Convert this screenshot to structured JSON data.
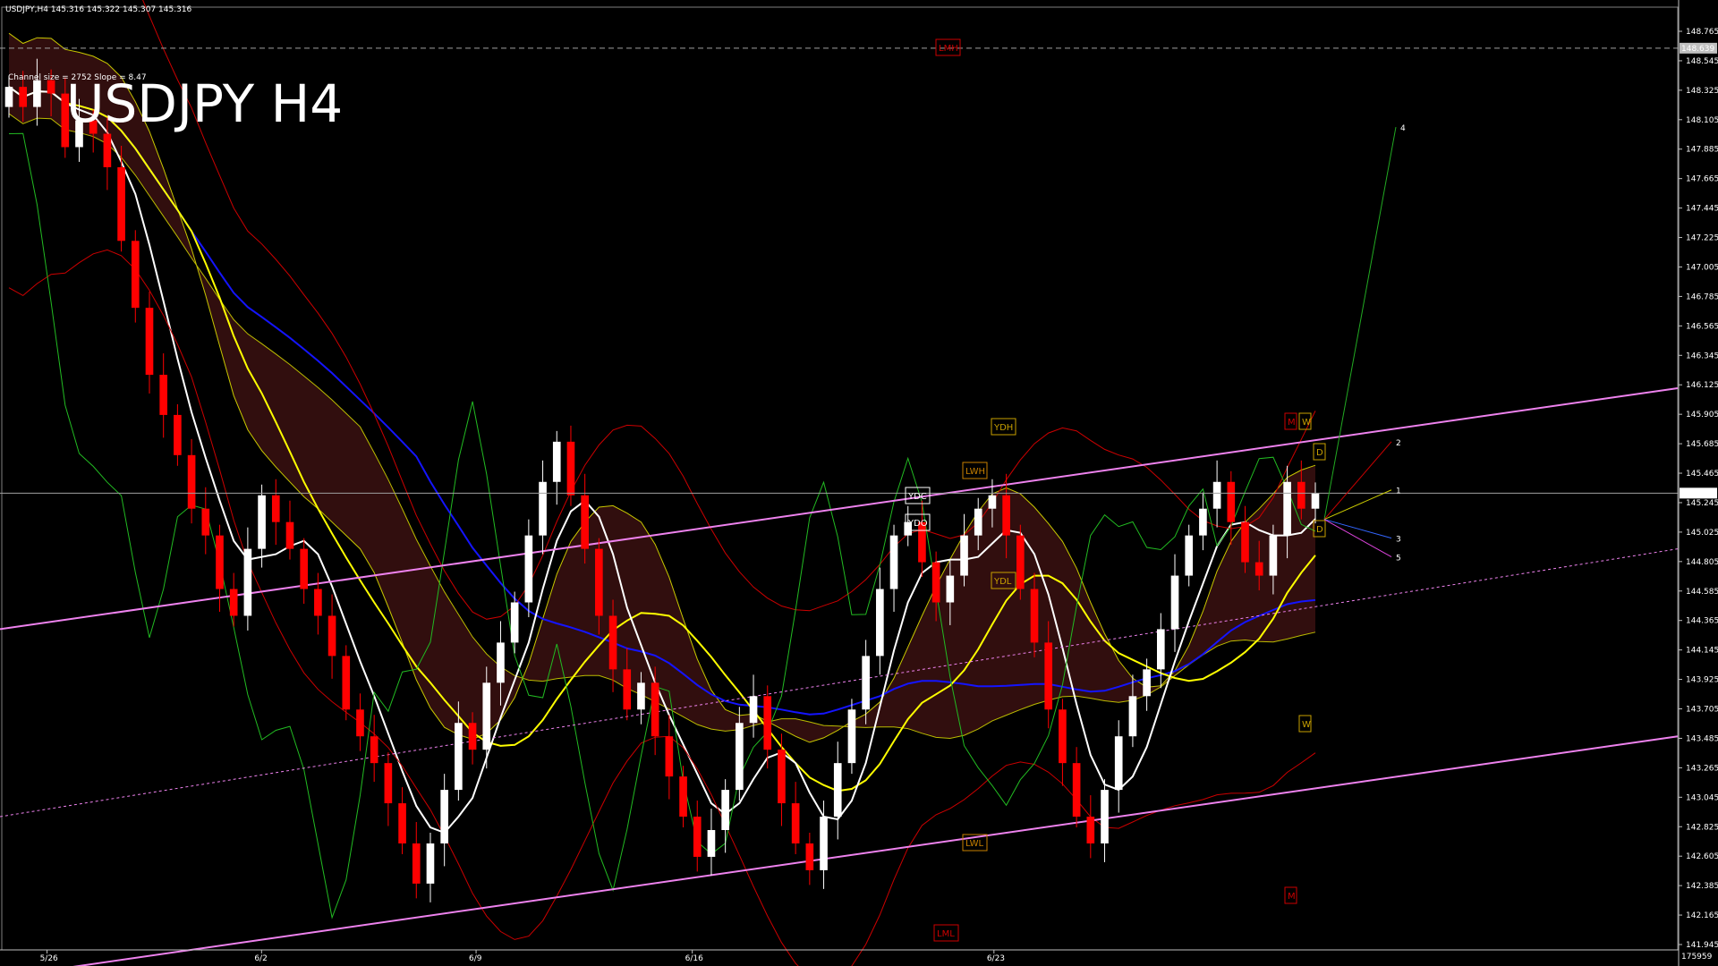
{
  "header": {
    "symbol_quote": "USDJPY,H4  145.316 145.322 145.307 145.316",
    "title": "USDJPY H4",
    "channel_info": "Channel size = 2752 Slope = 8.47"
  },
  "colors": {
    "background": "#000000",
    "axis": "#c0c0c0",
    "bull_candle": "#ffffff",
    "bear_candle": "#ff0000",
    "channel": "#ee82ee",
    "ma_white": "#ffffff",
    "ma_yellow": "#ffff00",
    "ma_blue": "#1414ff",
    "bollinger": "#cc0000",
    "ichimoku_span": "#c8c800",
    "chikou": "#22bb22",
    "projection_green": "#22aa22"
  },
  "chart_data": {
    "type": "candlestick",
    "title": "USDJPY H4",
    "ylim": [
      41.925,
      148.875
    ],
    "y_ticks": [
      "148.765",
      "148.545",
      "148.325",
      "148.105",
      "147.885",
      "147.665",
      "147.445",
      "147.225",
      "147.005",
      "146.785",
      "146.565",
      "146.345",
      "146.125",
      "145.905",
      "145.685",
      "145.465",
      "145.245",
      "145.025",
      "144.805",
      "144.585",
      "144.365",
      "144.145",
      "143.925",
      "143.705",
      "143.485",
      "143.265",
      "143.045",
      "142.825",
      "142.605",
      "142.385",
      "142.165",
      "141.945"
    ],
    "current_price_label": "145.316",
    "lmh_price_label": "148.639",
    "bottom_right_label": "175959",
    "x_labels": [
      {
        "label": "5/26",
        "pos": 0.027
      },
      {
        "label": "6/2",
        "pos": 0.155
      },
      {
        "label": "6/9",
        "pos": 0.283
      },
      {
        "label": "6/16",
        "pos": 0.412
      },
      {
        "label": "6/23",
        "pos": 0.592
      }
    ],
    "level_labels": [
      "LMH",
      "YDH",
      "LWH",
      "YDC",
      "YDO",
      "YDL",
      "LWL",
      "LML",
      "M",
      "W",
      "D",
      "D",
      "W",
      "M"
    ],
    "projection_labels": [
      "4",
      "2",
      "1",
      "3",
      "5"
    ],
    "series": {
      "close": [
        148.35,
        148.2,
        148.4,
        148.3,
        147.9,
        148.1,
        148.0,
        147.75,
        147.2,
        146.7,
        146.2,
        145.9,
        145.6,
        145.2,
        145.0,
        144.6,
        144.4,
        144.9,
        145.3,
        145.1,
        144.9,
        144.6,
        144.4,
        144.1,
        143.7,
        143.5,
        143.3,
        143.0,
        142.7,
        142.4,
        142.7,
        143.1,
        143.6,
        143.4,
        143.9,
        144.2,
        144.5,
        145.0,
        145.4,
        145.7,
        145.3,
        144.9,
        144.4,
        144.0,
        143.7,
        143.9,
        143.5,
        143.2,
        142.9,
        142.6,
        142.8,
        143.1,
        143.6,
        143.8,
        143.4,
        143.0,
        142.7,
        142.5,
        142.9,
        143.3,
        143.7,
        144.1,
        144.6,
        145.0,
        145.1,
        144.8,
        144.5,
        144.7,
        145.0,
        145.2,
        145.3,
        145.0,
        144.6,
        144.2,
        143.7,
        143.3,
        142.9,
        142.7,
        143.1,
        143.5,
        143.8,
        144.0,
        144.3,
        144.7,
        145.0,
        145.2,
        145.4,
        145.1,
        144.8,
        144.7,
        145.0,
        145.4,
        145.2,
        145.316
      ],
      "open": [
        148.2,
        148.35,
        148.2,
        148.4,
        148.3,
        147.9,
        148.1,
        148.0,
        147.75,
        147.2,
        146.7,
        146.2,
        145.9,
        145.6,
        145.2,
        145.0,
        144.6,
        144.4,
        144.9,
        145.3,
        145.1,
        144.9,
        144.6,
        144.4,
        144.1,
        143.7,
        143.5,
        143.3,
        143.0,
        142.7,
        142.4,
        142.7,
        143.1,
        143.6,
        143.4,
        143.9,
        144.2,
        144.5,
        145.0,
        145.4,
        145.7,
        145.3,
        144.9,
        144.4,
        144.0,
        143.7,
        143.9,
        143.5,
        143.2,
        142.9,
        142.6,
        142.8,
        143.1,
        143.6,
        143.8,
        143.4,
        143.0,
        142.7,
        142.5,
        142.9,
        143.3,
        143.7,
        144.1,
        144.6,
        145.0,
        145.1,
        144.8,
        144.5,
        144.7,
        145.0,
        145.2,
        145.3,
        145.0,
        144.6,
        144.2,
        143.7,
        143.3,
        142.9,
        142.7,
        143.1,
        143.5,
        143.8,
        144.0,
        144.3,
        144.7,
        145.0,
        145.2,
        145.4,
        145.1,
        144.8,
        144.7,
        145.0,
        145.4,
        145.2
      ]
    }
  }
}
